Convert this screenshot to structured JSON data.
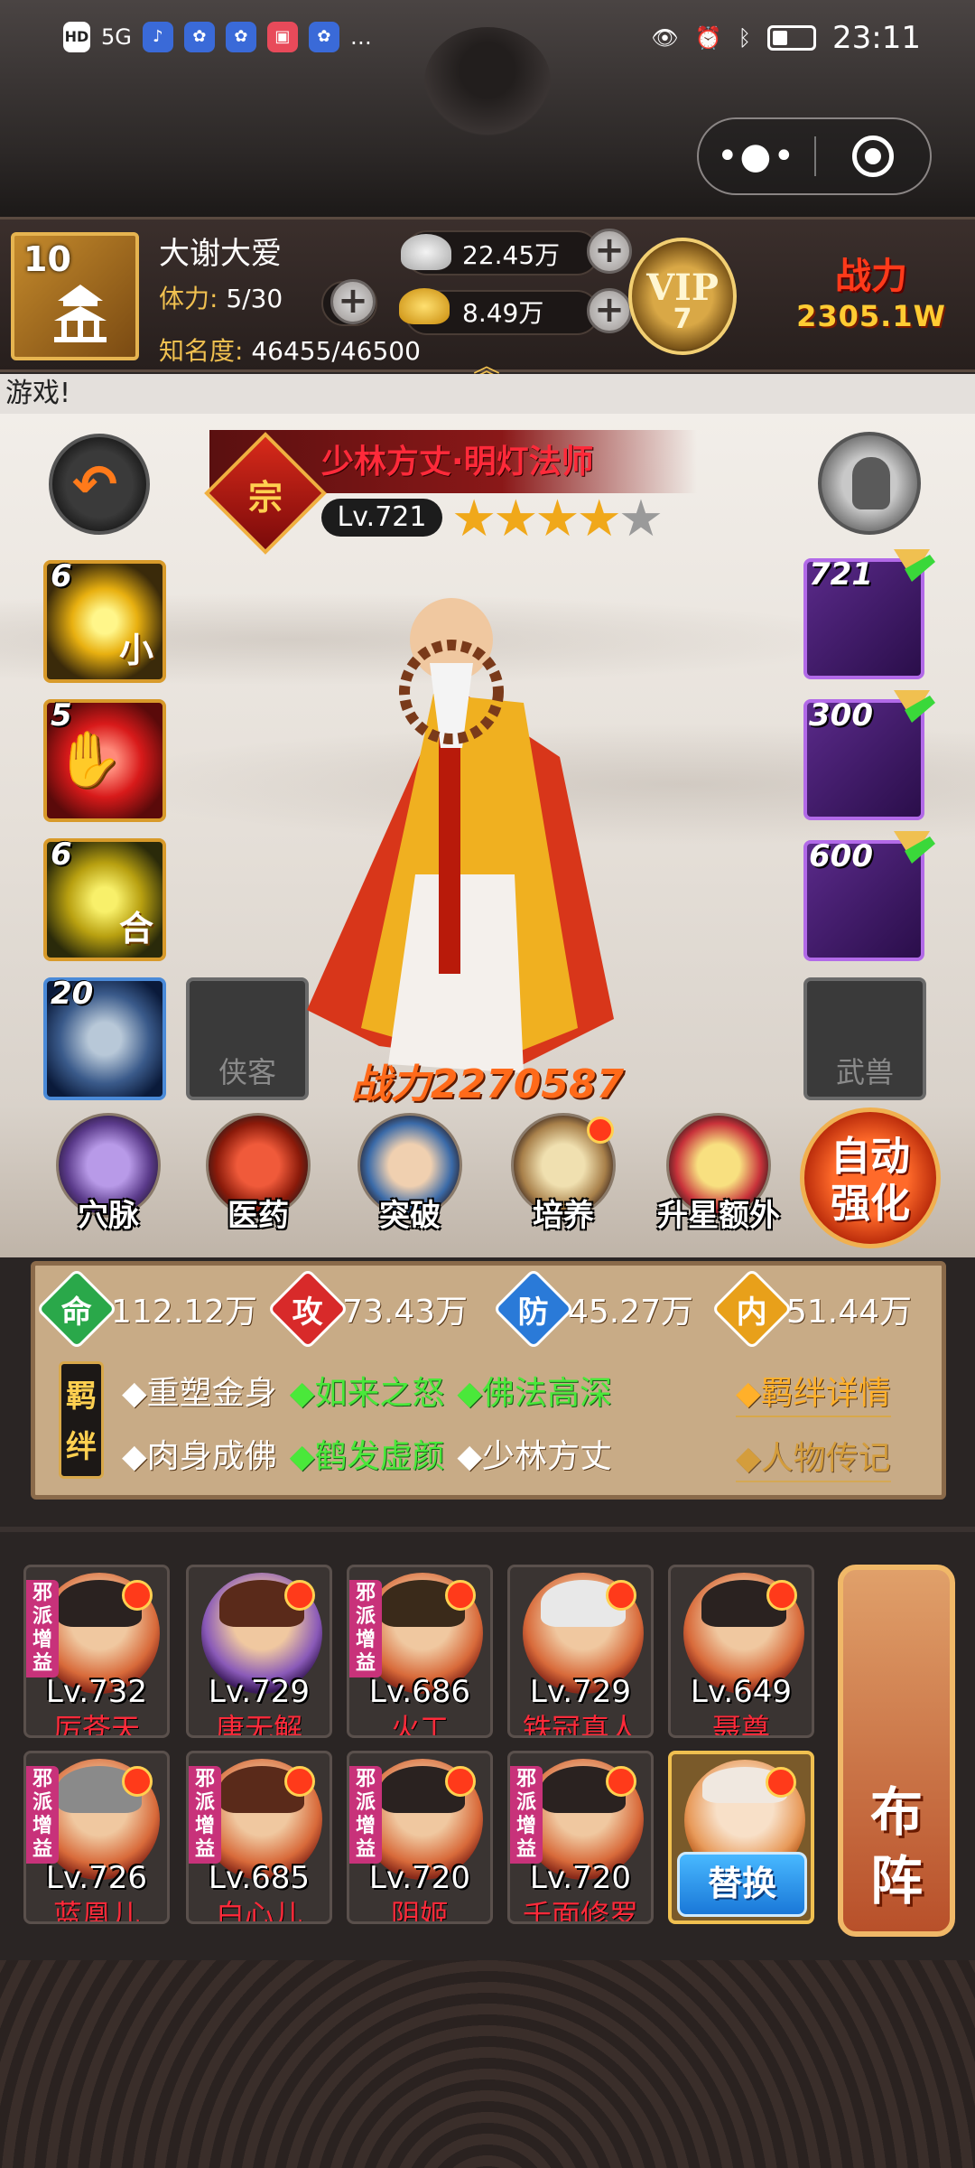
{
  "status_bar": {
    "left_labels": [
      "HD",
      "5G",
      "…"
    ],
    "time": "23:11"
  },
  "player": {
    "level": "10",
    "name": "大谢大爱",
    "stamina_label": "体力:",
    "stamina_value": "5/30",
    "fame_label": "知名度:",
    "fame_value": "46455/46500",
    "silver": "22.45万",
    "gold": "8.49万",
    "vip_label": "VIP",
    "vip_level": "7",
    "power_label": "战力",
    "power_value": "2305.1W"
  },
  "marquee": "游戏!",
  "hero": {
    "badge": "宗",
    "name": "少林方丈·明灯法师",
    "level": "Lv.721",
    "stars_filled": 4,
    "stars_total": 5,
    "power_label": "战力2270587"
  },
  "skills": [
    {
      "num": "6",
      "glyph": "小"
    },
    {
      "num": "5",
      "glyph": ""
    },
    {
      "num": "6",
      "glyph": "合"
    },
    {
      "num": "20",
      "glyph": ""
    }
  ],
  "empty_slots": {
    "companion": "侠客",
    "beast": "武兽"
  },
  "equipment": [
    {
      "num": "721"
    },
    {
      "num": "300"
    },
    {
      "num": "600"
    }
  ],
  "functions": [
    {
      "label": "穴脉",
      "dot": false
    },
    {
      "label": "医药",
      "dot": false
    },
    {
      "label": "突破",
      "dot": false
    },
    {
      "label": "培养",
      "dot": true
    },
    {
      "label": "升星额外",
      "dot": false
    }
  ],
  "auto_btn": {
    "line1": "自动",
    "line2": "强化"
  },
  "stats": [
    {
      "icon": "命",
      "value": "112.12万",
      "color": "#2aa84a"
    },
    {
      "icon": "攻",
      "value": "73.43万",
      "color": "#d82a2a"
    },
    {
      "icon": "防",
      "value": "45.27万",
      "color": "#2a7ad8"
    },
    {
      "icon": "内",
      "value": "51.44万",
      "color": "#e8a01a"
    }
  ],
  "bond": {
    "tag_top": "羁",
    "tag_bottom": "绊",
    "row1": [
      {
        "text": "◆重塑金身",
        "active": false
      },
      {
        "text": "◆如来之怒",
        "active": true
      },
      {
        "text": "◆佛法高深",
        "active": true
      }
    ],
    "row2": [
      {
        "text": "◆肉身成佛",
        "active": false
      },
      {
        "text": "◆鹤发虚颜",
        "active": true
      },
      {
        "text": "◆少林方丈",
        "active": false
      }
    ],
    "detail_link": "◆羁绊详情",
    "bio_link": "◆人物传记"
  },
  "evil_tag": "邪派增益",
  "team": [
    {
      "level": "Lv.732",
      "name": "厉苍天",
      "evil": true
    },
    {
      "level": "Lv.729",
      "name": "唐无解",
      "evil": false
    },
    {
      "level": "Lv.686",
      "name": "火工",
      "evil": true
    },
    {
      "level": "Lv.729",
      "name": "铁冠真人",
      "evil": false
    },
    {
      "level": "Lv.649",
      "name": "聂尊",
      "evil": false
    },
    {
      "level": "Lv.726",
      "name": "蓝凰儿",
      "evil": true
    },
    {
      "level": "Lv.685",
      "name": "白心儿",
      "evil": true
    },
    {
      "level": "Lv.720",
      "name": "阴姬",
      "evil": true
    },
    {
      "level": "Lv.720",
      "name": "千面修罗",
      "evil": true
    }
  ],
  "swap_label": "替换",
  "formation": {
    "line1": "布",
    "line2": "阵"
  }
}
